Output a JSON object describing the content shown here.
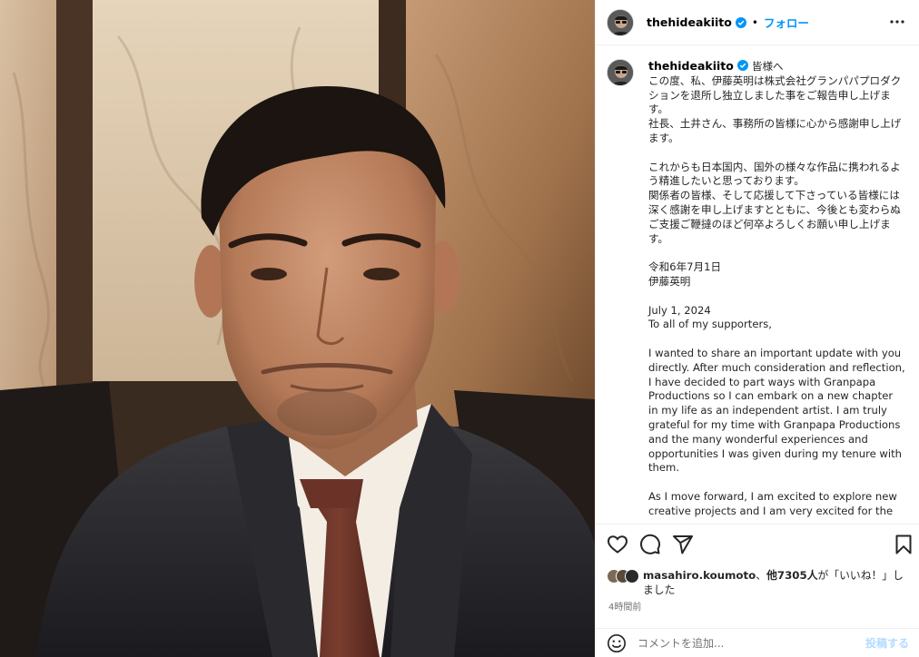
{
  "post": {
    "username": "thehideakiito",
    "verified": true,
    "separator": "•",
    "follow_label": "フォロー",
    "more_icon": "more-horizontal-icon"
  },
  "caption": {
    "greeting": "皆様へ",
    "text": "この度、私、伊藤英明は株式会社グランパパプロダクションを退所し独立しました事をご報告申し上げます。\n社長、土井さん、事務所の皆様に心から感謝申し上げます。\n\nこれからも日本国内、国外の様々な作品に携われるよう精進したいと思っております。\n関係者の皆様、そして応援して下さっている皆様には深く感謝を申し上げますとともに、今後とも変わらぬご支援ご鞭撻のほど何卒よろしくお願い申し上げます。\n\n令和6年7月1日\n伊藤英明\n\nJuly 1, 2024\nTo all of my supporters,\n\nI wanted to share an important update with you directly. After much consideration and reflection, I have decided to part ways with Granpapa Productions so I can embark on a new chapter in my life as an independent artist. I am truly grateful for my time with Granpapa Productions and the many wonderful experiences and opportunities I was given during my tenure with them.\n\nAs I move forward, I am excited to explore new creative projects and I am very excited for the"
  },
  "actions": {
    "icons": [
      "heart-icon",
      "comment-icon",
      "share-icon",
      "bookmark-icon"
    ]
  },
  "likes": {
    "user": "masahiro.koumoto",
    "sep": "、",
    "others": "他7305人",
    "suffix": "が「いいね！」しました"
  },
  "timestamp": "4時間前",
  "comment": {
    "placeholder": "コメントを追加...",
    "post_label": "投稿する"
  },
  "colors": {
    "accent": "#0095f6",
    "post_disabled": "#b3dbff",
    "verified": "#0095f6"
  }
}
